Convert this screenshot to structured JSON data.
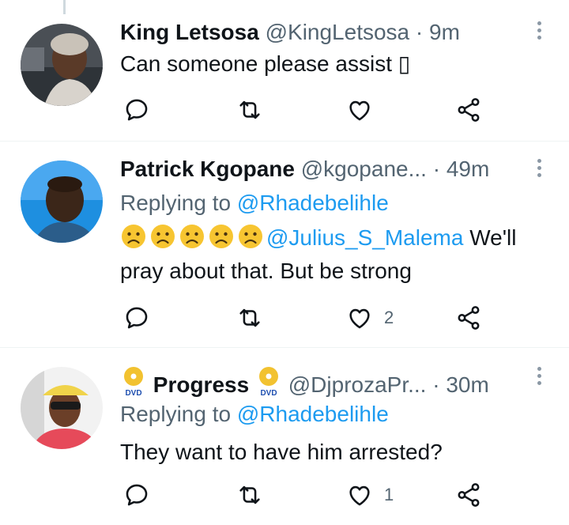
{
  "tweets": [
    {
      "name": "King Letsosa",
      "handle": "@KingLetsosa",
      "separator": "·",
      "time": "9m",
      "text": "Can someone please assist ▯",
      "reply_count": "",
      "retweet_count": "",
      "like_count": ""
    },
    {
      "name": "Patrick Kgopane",
      "handle": "@kgopane...",
      "separator": "·",
      "time": "49m",
      "replying_label": "Replying to",
      "replying_to": "@Rhadebelihle",
      "mention": "@Julius_S_Malema",
      "text_part1": "We'll",
      "text_part2": "pray about that. But be strong",
      "reply_count": "",
      "retweet_count": "",
      "like_count": "2"
    },
    {
      "name": "Progress",
      "handle": "@DjprozaPr...",
      "separator": "·",
      "time": "30m",
      "replying_label": "Replying to",
      "replying_to": "@Rhadebelihle",
      "text": "They want to have him arrested?",
      "reply_count": "",
      "retweet_count": "",
      "like_count": "1"
    }
  ],
  "colors": {
    "text": "#0f1419",
    "secondary": "#536471",
    "link": "#1d9bf0",
    "divider": "#eff3f4",
    "thread_line": "#cfd9de"
  },
  "icons": [
    "reply-icon",
    "retweet-icon",
    "like-icon",
    "share-icon",
    "more-icon",
    "sad-face-emoji",
    "dvd-emoji"
  ]
}
